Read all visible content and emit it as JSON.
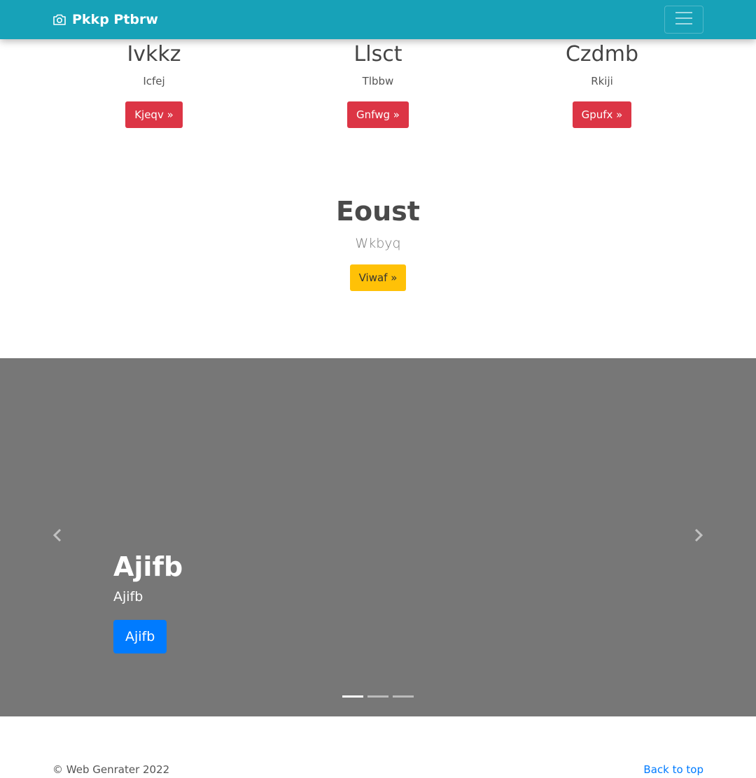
{
  "navbar": {
    "brand": "Pkkp Ptbrw",
    "brand_icon": "camera-icon",
    "toggler_icon": "menu-icon",
    "background": "#17a2b8"
  },
  "features": [
    {
      "title": "Ivkkz",
      "text": "Icfej",
      "button": "Kjeqv »"
    },
    {
      "title": "Llsct",
      "text": "Tlbbw",
      "button": "Gnfwg »"
    },
    {
      "title": "Czdmb",
      "text": "Rkiji",
      "button": "Gpufx »"
    }
  ],
  "center": {
    "title": "Eoust",
    "text": "Wkbyq",
    "button": "Viwaf »"
  },
  "carousel": {
    "title": "Ajifb",
    "text": "Ajifb",
    "button": "Ajifb",
    "prev_icon": "chevron-left-icon",
    "next_icon": "chevron-right-icon",
    "slide_count": 3,
    "active_slide": 1,
    "background": "#777777"
  },
  "footer": {
    "copyright": "© Web Genrater 2022",
    "back_to_top": "Back to top"
  },
  "colors": {
    "danger": "#dc3545",
    "warning": "#ffc107",
    "primary": "#007bff"
  }
}
